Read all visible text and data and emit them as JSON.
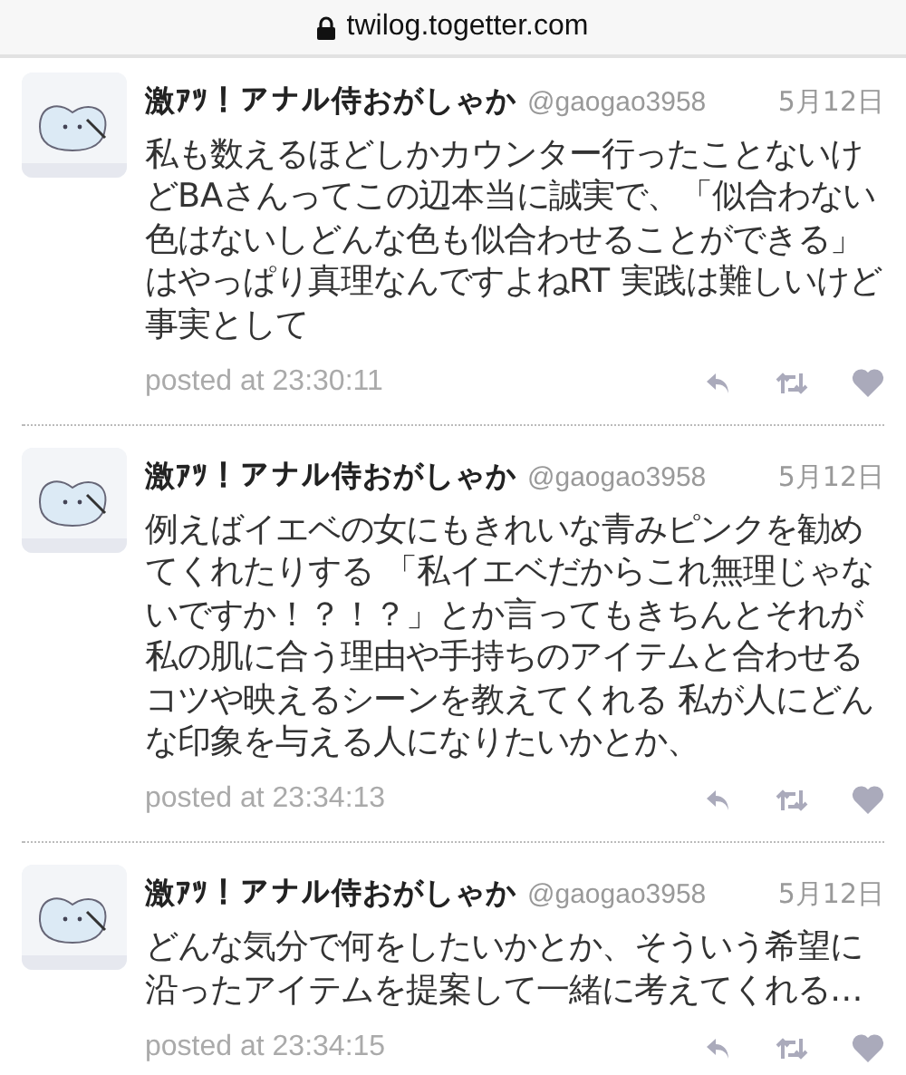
{
  "address_bar": {
    "url": "twilog.togetter.com"
  },
  "tweets": [
    {
      "name": "激ｱﾂ！アナル侍おがしゃか",
      "handle": "@gaogao3958",
      "date": "5月12日",
      "text": "私も数えるほどしかカウンター行ったことないけどBAさんってこの辺本当に誠実で、「似合わない色はないしどんな色も似合わせることができる」はやっぱり真理なんですよねRT 実践は難しいけど事実として",
      "posted": "posted at 23:30:11"
    },
    {
      "name": "激ｱﾂ！アナル侍おがしゃか",
      "handle": "@gaogao3958",
      "date": "5月12日",
      "text": "例えばイエベの女にもきれいな青みピンクを勧めてくれたりする 「私イエベだからこれ無理じゃないですか！？！？」とか言ってもきちんとそれが私の肌に合う理由や手持ちのアイテムと合わせるコツや映えるシーンを教えてくれる 私が人にどんな印象を与える人になりたいかとか、",
      "posted": "posted at 23:34:13"
    },
    {
      "name": "激ｱﾂ！アナル侍おがしゃか",
      "handle": "@gaogao3958",
      "date": "5月12日",
      "text": "どんな気分で何をしたいかとか、そういう希望に沿ったアイテムを提案して一緒に考えてくれる…",
      "posted": "posted at 23:34:15"
    }
  ]
}
